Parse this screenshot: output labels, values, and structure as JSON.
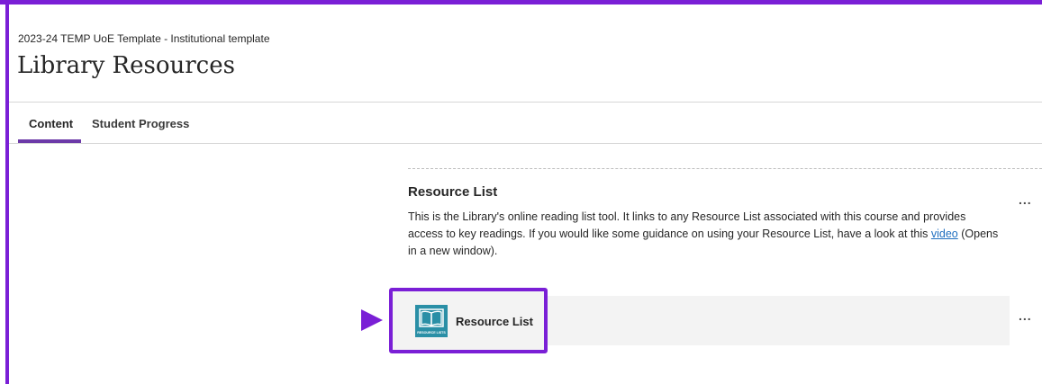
{
  "colors": {
    "highlight": "#7a1fd6",
    "tab_accent": "#6c3aa8",
    "link": "#1f6fbf",
    "icon_bg": "#2a8fa6"
  },
  "header": {
    "course_name": "2023-24 TEMP UoE Template - Institutional template",
    "page_title": "Library Resources"
  },
  "tabs": [
    {
      "label": "Content",
      "active": true
    },
    {
      "label": "Student Progress",
      "active": false
    }
  ],
  "content": {
    "item_title": "Resource List",
    "description_part1": "This is the Library's online reading list tool. It links to any Resource List associated with this course and provides access to key readings. If you would like some guidance on using your Resource List, have a look at this ",
    "link_text": "video",
    "description_part2": " (Opens in a new window).",
    "more_options": "...",
    "tool": {
      "label": "Resource List",
      "icon_caption": "RESOURCE LISTS",
      "icon": "resource-lists-book-icon"
    },
    "tool_more_options": "..."
  }
}
